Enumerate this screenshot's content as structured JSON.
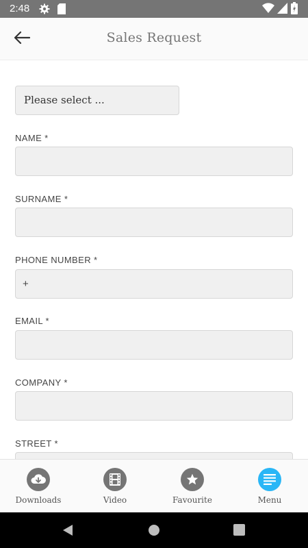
{
  "status_bar": {
    "time": "2:48",
    "icons": [
      "settings-gear-icon",
      "sd-card-icon",
      "wifi-icon",
      "signal-icon",
      "battery-icon"
    ]
  },
  "header": {
    "title": "Sales Request",
    "back_icon": "arrow-left-icon"
  },
  "form": {
    "select": {
      "value": "Please select ..."
    },
    "fields": [
      {
        "label": "NAME *",
        "value": ""
      },
      {
        "label": "SURNAME *",
        "value": ""
      },
      {
        "label": "PHONE NUMBER *",
        "value": "+"
      },
      {
        "label": "EMAIL *",
        "value": ""
      },
      {
        "label": "COMPANY *",
        "value": ""
      },
      {
        "label": "STREET *",
        "value": ""
      }
    ]
  },
  "bottom_nav": {
    "items": [
      {
        "label": "Downloads",
        "icon": "cloud-download-icon",
        "active": false
      },
      {
        "label": "Video",
        "icon": "film-icon",
        "active": false
      },
      {
        "label": "Favourite",
        "icon": "star-icon",
        "active": false
      },
      {
        "label": "Menu",
        "icon": "menu-lines-icon",
        "active": true
      }
    ]
  },
  "system_nav": {
    "icons": [
      "back-triangle-icon",
      "home-circle-icon",
      "recents-square-icon"
    ]
  },
  "colors": {
    "status_bar": "#757575",
    "accent": "#29b6f6",
    "inactive_icon": "#757575",
    "input_bg": "#f0f0f0"
  }
}
